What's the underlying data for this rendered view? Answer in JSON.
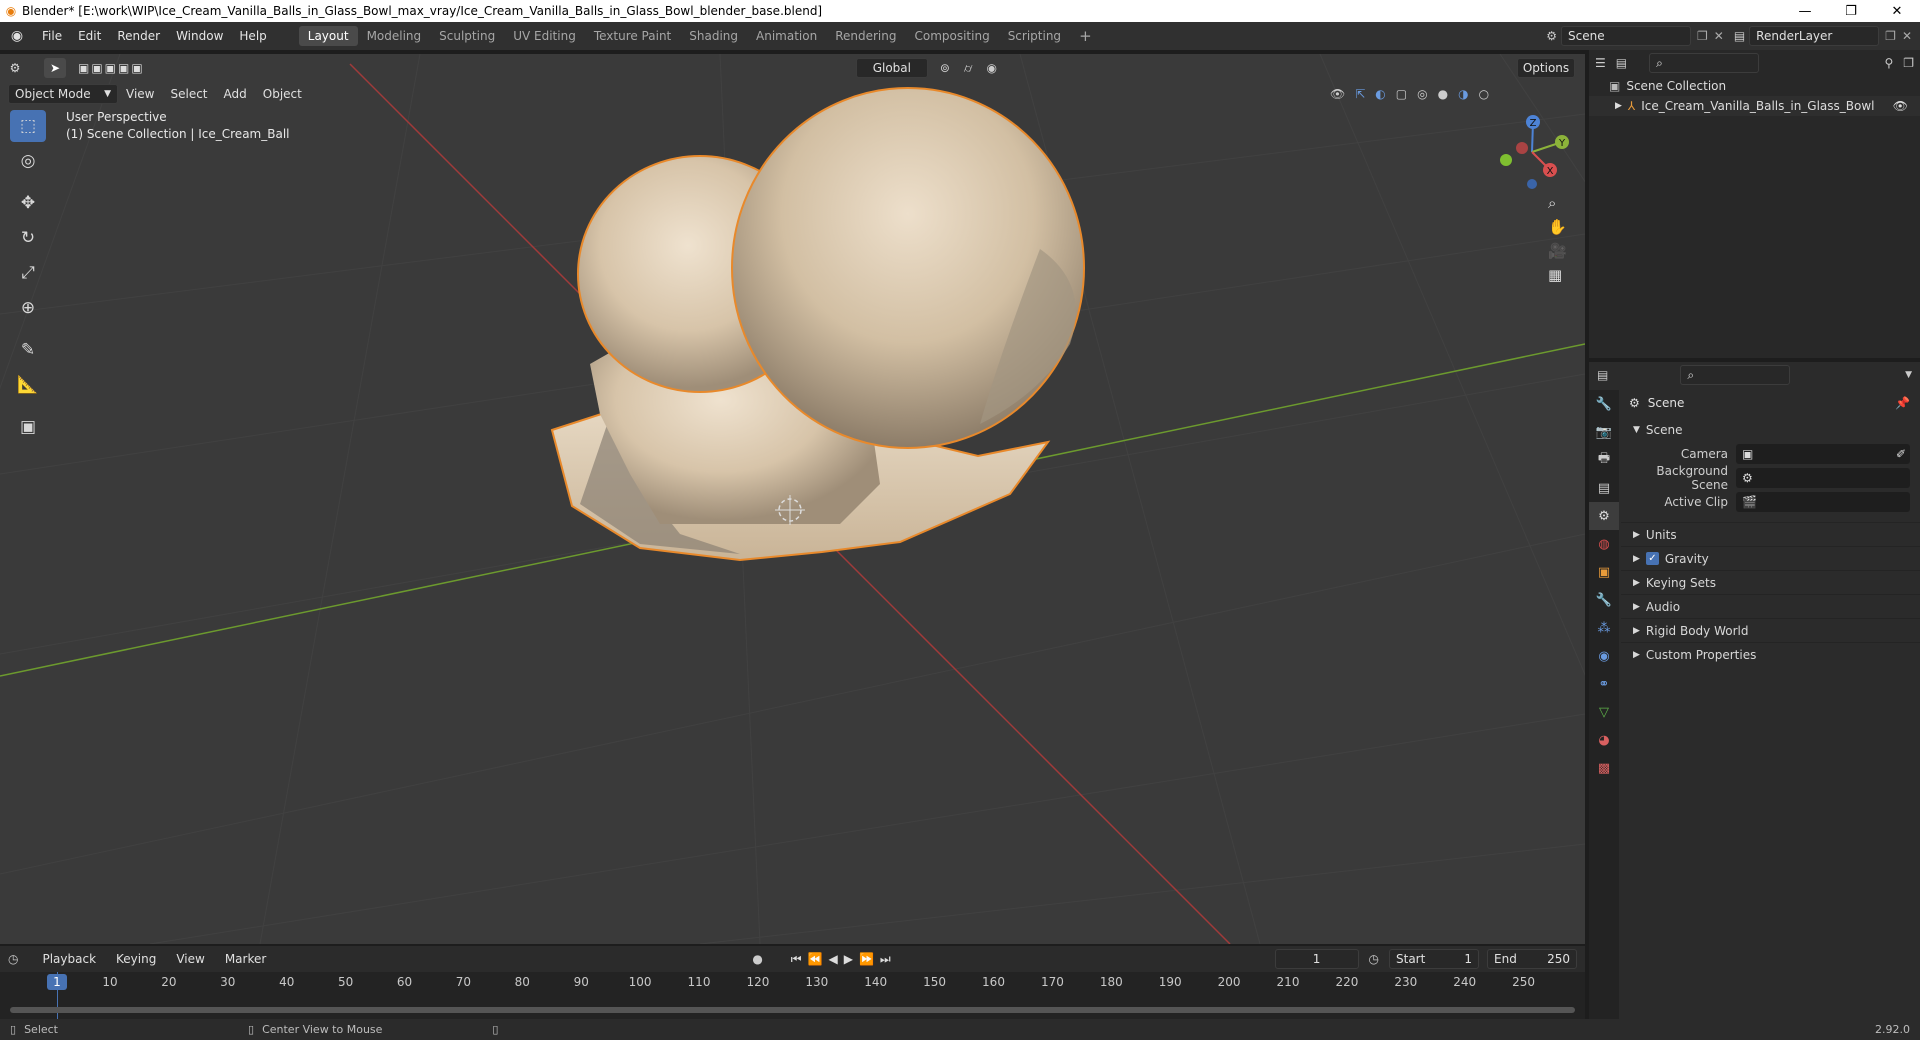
{
  "window": {
    "title": "Blender* [E:\\work\\WIP\\Ice_Cream_Vanilla_Balls_in_Glass_Bowl_max_vray/Ice_Cream_Vanilla_Balls_in_Glass_Bowl_blender_base.blend]"
  },
  "menu": [
    "File",
    "Edit",
    "Render",
    "Window",
    "Help"
  ],
  "workspaces": [
    "Layout",
    "Modeling",
    "Sculpting",
    "UV Editing",
    "Texture Paint",
    "Shading",
    "Animation",
    "Rendering",
    "Compositing",
    "Scripting"
  ],
  "active_workspace": "Layout",
  "scene_field": "Scene",
  "renderlayer_field": "RenderLayer",
  "viewport_header": {
    "orientation": "Global",
    "options": "Options",
    "mode": "Object Mode",
    "menus": [
      "View",
      "Select",
      "Add",
      "Object"
    ]
  },
  "viewport": {
    "perspective_label": "User Perspective",
    "collection_label": "(1) Scene Collection | Ice_Cream_Ball",
    "gizmo_axes": {
      "x": "X",
      "y": "Y",
      "z": "Z"
    }
  },
  "outliner": {
    "root": "Scene Collection",
    "items": [
      "Ice_Cream_Vanilla_Balls_in_Glass_Bowl"
    ]
  },
  "properties": {
    "context": "Scene",
    "section": "Scene",
    "fields": [
      {
        "label": "Camera",
        "value": ""
      },
      {
        "label": "Background Scene",
        "value": ""
      },
      {
        "label": "Active Clip",
        "value": ""
      }
    ],
    "panels": [
      "Units",
      "Gravity",
      "Keying Sets",
      "Audio",
      "Rigid Body World",
      "Custom Properties"
    ],
    "gravity_checked": true
  },
  "timeline": {
    "menus": [
      "Playback",
      "Keying",
      "View",
      "Marker"
    ],
    "current_frame": "1",
    "start_label": "Start",
    "start": "1",
    "end_label": "End",
    "end": "250",
    "ruler": [
      1,
      10,
      20,
      30,
      40,
      50,
      60,
      70,
      80,
      90,
      100,
      110,
      120,
      130,
      140,
      150,
      160,
      170,
      180,
      190,
      200,
      210,
      220,
      230,
      240,
      250
    ]
  },
  "status": {
    "left": "Select",
    "middle": "Center View to Mouse",
    "version": "2.92.0"
  },
  "colors": {
    "accent": "#4772b3",
    "selection_outline": "#e8892b",
    "x_axis": "#a03a3a",
    "y_axis": "#6c9a2e"
  }
}
